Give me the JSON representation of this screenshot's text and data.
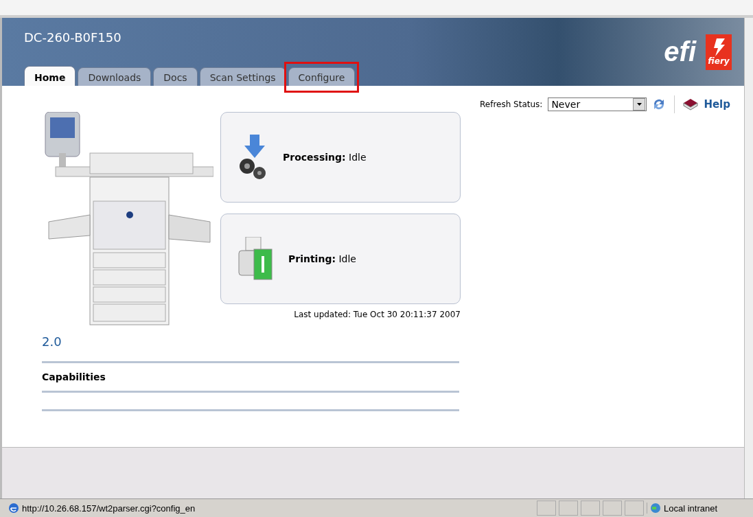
{
  "header": {
    "device_name": "DC-260-B0F150",
    "logo_text": "efi",
    "badge_text": "fiery"
  },
  "tabs": [
    {
      "label": "Home",
      "selected": true,
      "highlighted": false
    },
    {
      "label": "Downloads",
      "selected": false,
      "highlighted": false
    },
    {
      "label": "Docs",
      "selected": false,
      "highlighted": false
    },
    {
      "label": "Scan Settings",
      "selected": false,
      "highlighted": false
    },
    {
      "label": "Configure",
      "selected": false,
      "highlighted": true
    }
  ],
  "refresh": {
    "label": "Refresh Status:",
    "value": "Never"
  },
  "help": {
    "label": "Help"
  },
  "version": "2.0",
  "status_cards": [
    {
      "kind": "processing",
      "label": "Processing:",
      "value": "Idle"
    },
    {
      "kind": "printing",
      "label": "Printing:",
      "value": "Idle"
    }
  ],
  "last_updated": "Last updated: Tue Oct 30 20:11:37 2007",
  "sections": [
    {
      "title": "Capabilities"
    }
  ],
  "status_bar": {
    "url": "http://10.26.68.157/wt2parser.cgi?config_en",
    "zone": "Local intranet"
  }
}
